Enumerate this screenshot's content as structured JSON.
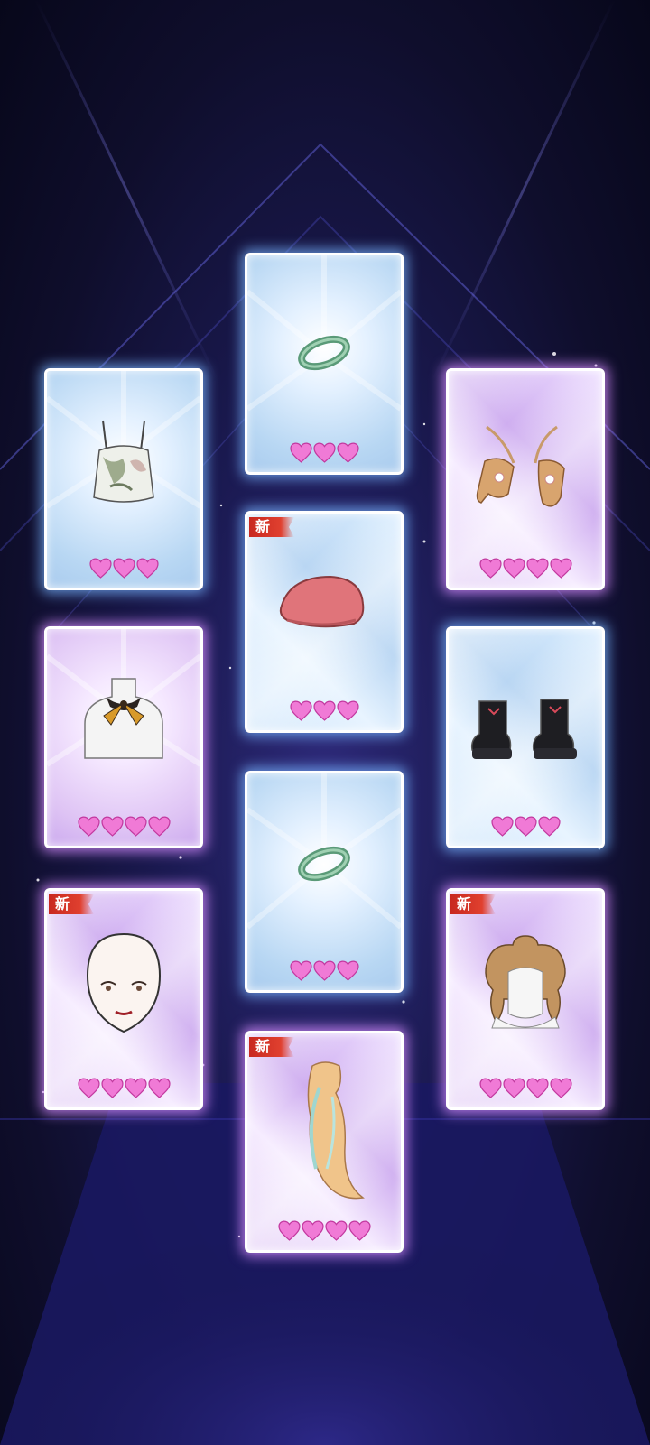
{
  "new_label": "新",
  "cards": [
    {
      "name": "card-camisole-top",
      "theme": "blue",
      "item": "camisole-top-icon",
      "hearts": 3,
      "new": false
    },
    {
      "name": "card-jade-bracelet-1",
      "theme": "blue",
      "item": "jade-bracelet-icon",
      "hearts": 3,
      "new": false
    },
    {
      "name": "card-strappy-heels",
      "theme": "pink",
      "item": "strappy-heels-icon",
      "hearts": 4,
      "new": false
    },
    {
      "name": "card-scarf-necklace",
      "theme": "pink",
      "item": "scarf-necklace-icon",
      "hearts": 4,
      "new": false
    },
    {
      "name": "card-beret-hat",
      "theme": "blue",
      "item": "beret-hat-icon",
      "hearts": 3,
      "new": true
    },
    {
      "name": "card-platform-boots",
      "theme": "blue",
      "item": "platform-boots-icon",
      "hearts": 3,
      "new": false
    },
    {
      "name": "card-jade-bracelet-2",
      "theme": "blue",
      "item": "jade-bracelet-icon",
      "hearts": 3,
      "new": false
    },
    {
      "name": "card-makeup-face",
      "theme": "pink",
      "item": "makeup-face-icon",
      "hearts": 4,
      "new": true
    },
    {
      "name": "card-curly-updo-hair",
      "theme": "pink",
      "item": "curly-updo-hair-icon",
      "hearts": 4,
      "new": true
    },
    {
      "name": "card-long-pastel-hair",
      "theme": "pink",
      "item": "long-pastel-hair-icon",
      "hearts": 4,
      "new": true
    }
  ]
}
